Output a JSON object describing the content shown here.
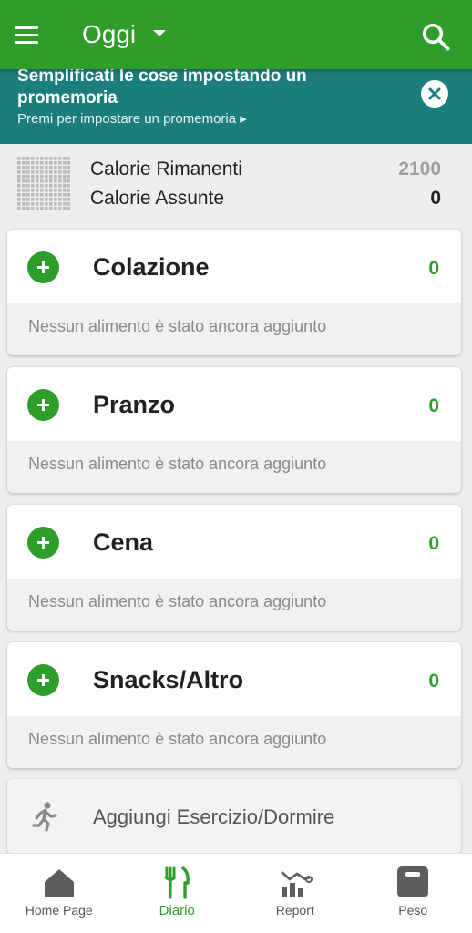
{
  "app_bar": {
    "title": "Oggi",
    "menu_icon": "menu-icon",
    "title_dropdown_icon": "caret-down-icon",
    "search_icon": "search-icon"
  },
  "reminder_banner": {
    "title": "Semplificati le cose impostando un promemoria",
    "subtitle": "Premi per impostare un promemoria ▸",
    "close_icon": "close-icon"
  },
  "summary": {
    "remaining_label": "Calorie Rimanenti",
    "remaining_value": "2100",
    "consumed_label": "Calorie Assunte",
    "consumed_value": "0"
  },
  "meals": [
    {
      "name": "Colazione",
      "kcal": "0",
      "empty_text": "Nessun alimento è stato ancora aggiunto"
    },
    {
      "name": "Pranzo",
      "kcal": "0",
      "empty_text": "Nessun alimento è stato ancora aggiunto"
    },
    {
      "name": "Cena",
      "kcal": "0",
      "empty_text": "Nessun alimento è stato ancora aggiunto"
    },
    {
      "name": "Snacks/Altro",
      "kcal": "0",
      "empty_text": "Nessun alimento è stato ancora aggiunto"
    }
  ],
  "exercise": {
    "label": "Aggiungi Esercizio/Dormire",
    "icon": "running-person-icon"
  },
  "bottom_nav": [
    {
      "label": "Home Page",
      "icon": "home-icon",
      "active": false
    },
    {
      "label": "Diario",
      "icon": "fork-knife-icon",
      "active": true
    },
    {
      "label": "Report",
      "icon": "chart-icon",
      "active": false
    },
    {
      "label": "Peso",
      "icon": "scale-icon",
      "active": false
    }
  ],
  "colors": {
    "primary_green": "#2e9d2a",
    "banner_teal": "#1b7e7b",
    "muted_gray": "#9e9e9e"
  }
}
